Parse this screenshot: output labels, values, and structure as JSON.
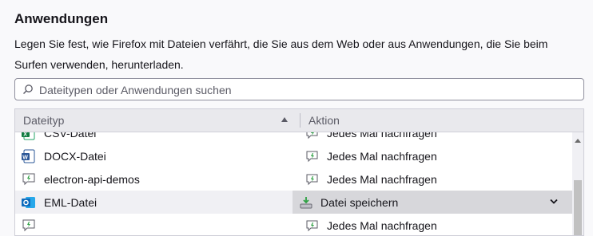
{
  "section": {
    "title": "Anwendungen",
    "description": "Legen Sie fest, wie Firefox mit Dateien verfährt, die Sie aus dem Web oder aus Anwendungen, die Sie beim Surfen verwenden, herunterladen."
  },
  "search": {
    "placeholder": "Dateitypen oder Anwendungen suchen",
    "value": ""
  },
  "table": {
    "headers": {
      "type": "Dateityp",
      "action": "Aktion"
    },
    "rows": [
      {
        "type": "CSV-Datei",
        "type_icon": "excel-icon",
        "action": "Jedes Mal nachfragen",
        "action_icon": "ask-icon"
      },
      {
        "type": "DOCX-Datei",
        "type_icon": "word-icon",
        "action": "Jedes Mal nachfragen",
        "action_icon": "ask-icon"
      },
      {
        "type": "electron-api-demos",
        "type_icon": "generic-file-icon",
        "action": "Jedes Mal nachfragen",
        "action_icon": "ask-icon"
      },
      {
        "type": "EML-Datei",
        "type_icon": "outlook-icon",
        "action": "Datei speichern",
        "action_icon": "save-file-icon",
        "selected": true
      },
      {
        "type": "",
        "type_icon": "generic-file-icon",
        "action": "Jedes Mal nachfragen",
        "action_icon": "ask-icon"
      }
    ]
  },
  "colors": {
    "accent_green": "#2ea043",
    "word_blue": "#2b5797",
    "outlook_blue": "#0f6cbd"
  }
}
